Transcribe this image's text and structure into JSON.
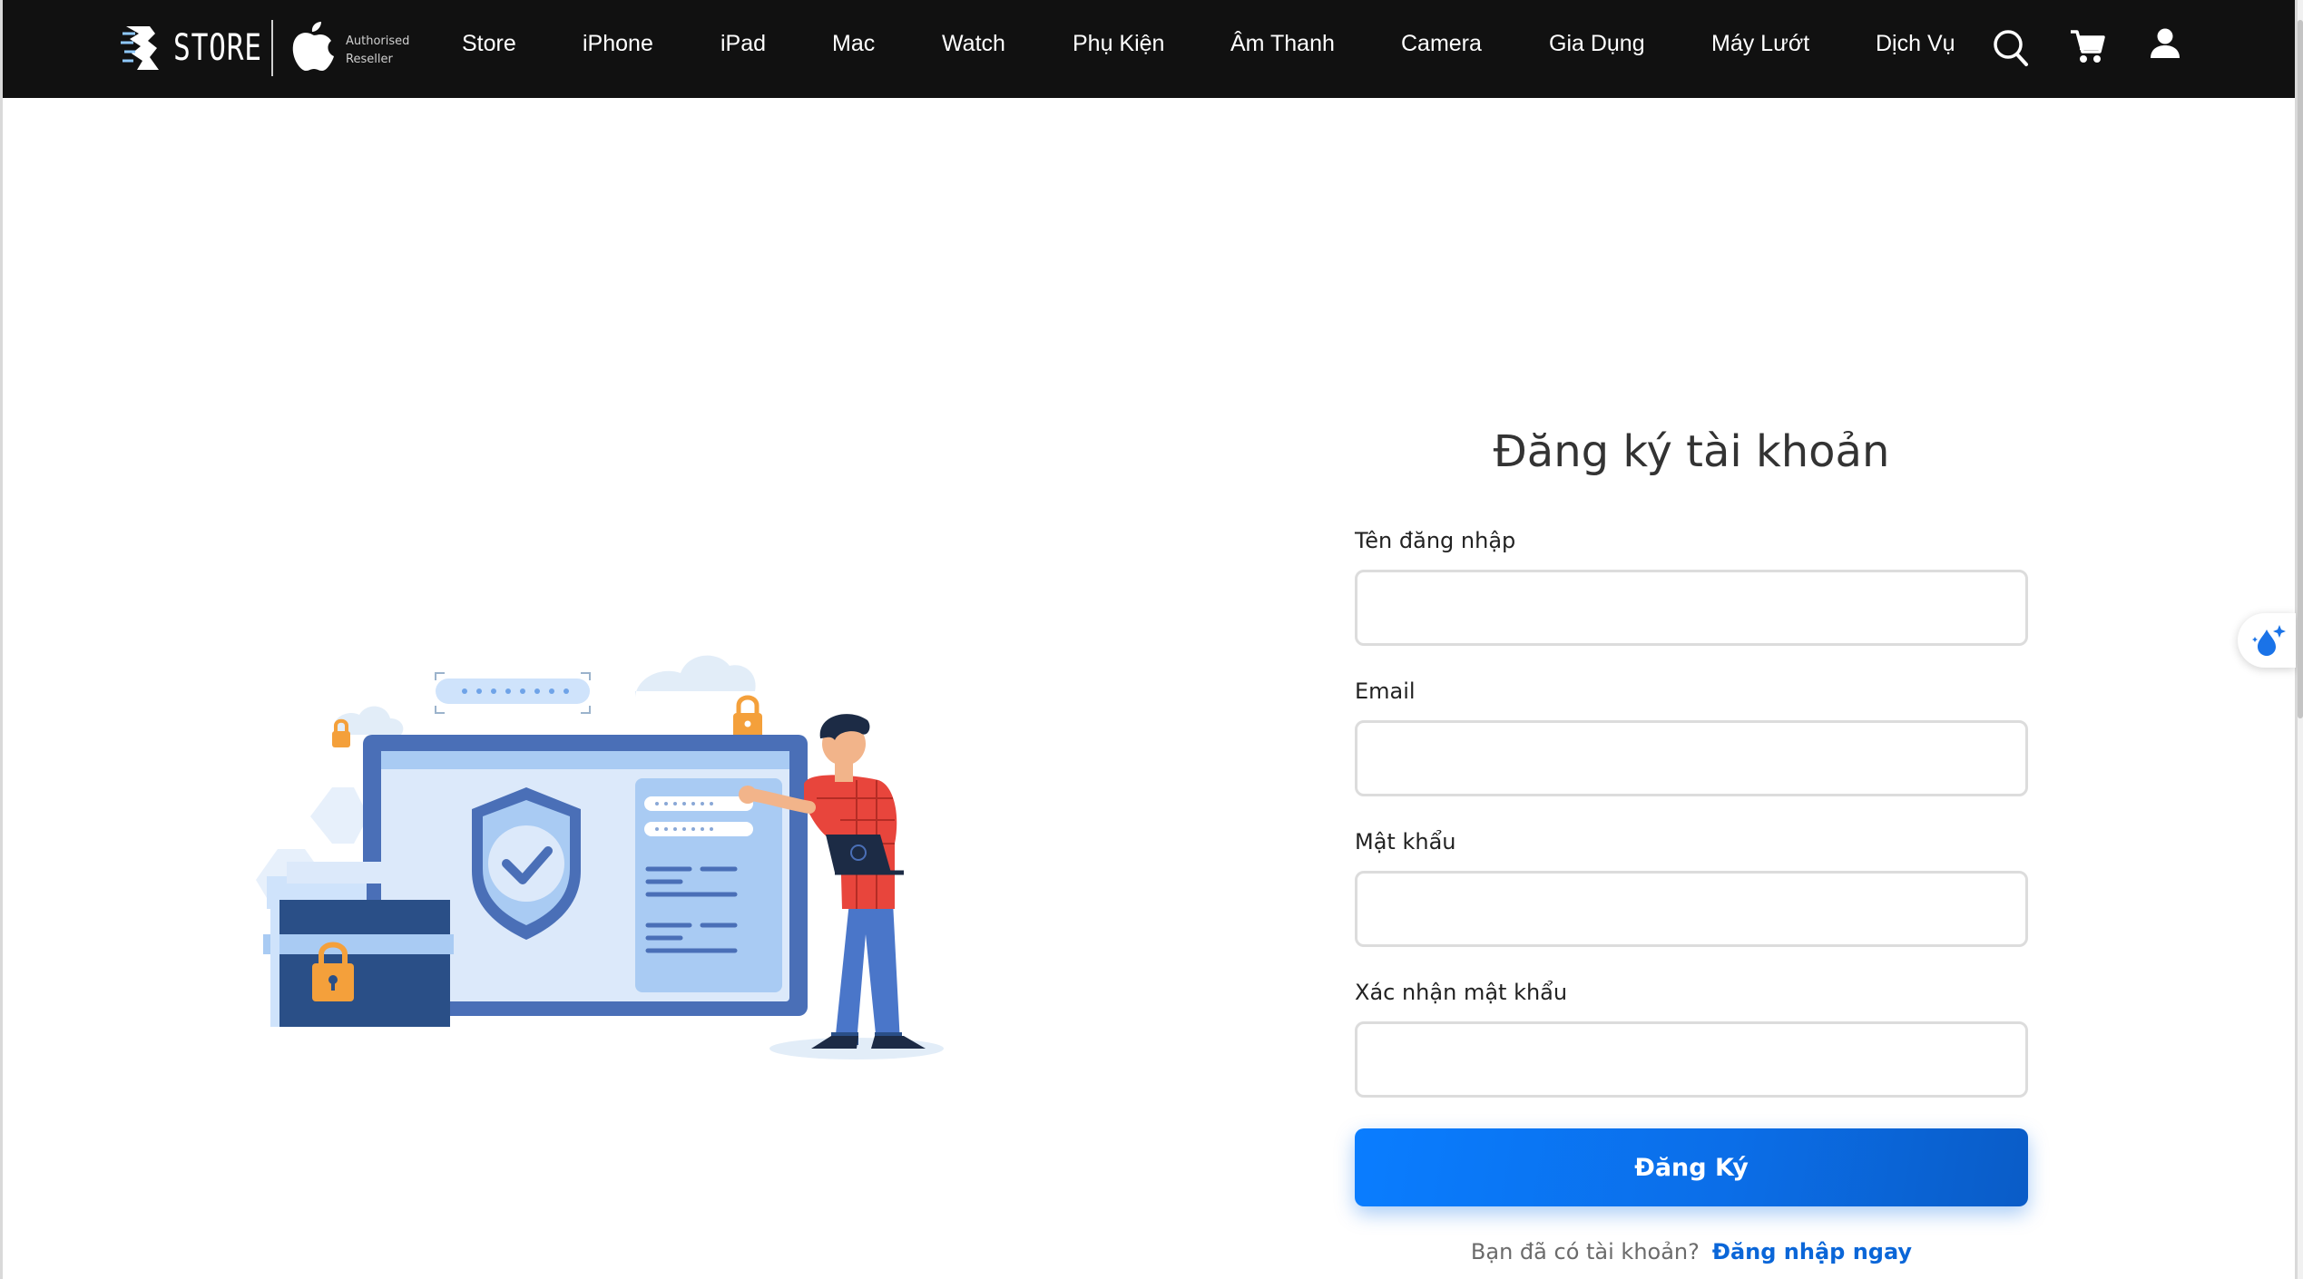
{
  "header": {
    "brand_text": "STORE",
    "reseller_line1": "Authorised",
    "reseller_line2": "Reseller",
    "nav": [
      {
        "label": "Store"
      },
      {
        "label": "iPhone"
      },
      {
        "label": "iPad"
      },
      {
        "label": "Mac"
      },
      {
        "label": "Watch"
      },
      {
        "label": "Phụ Kiện"
      },
      {
        "label": "Âm Thanh"
      },
      {
        "label": "Camera"
      },
      {
        "label": "Gia Dụng"
      },
      {
        "label": "Máy Lướt"
      },
      {
        "label": "Dịch Vụ"
      }
    ],
    "icons": [
      "search-icon",
      "cart-icon",
      "user-icon"
    ]
  },
  "form": {
    "title": "Đăng ký tài khoản",
    "username_label": "Tên đăng nhập",
    "username_value": "",
    "email_label": "Email",
    "email_value": "",
    "password_label": "Mật khẩu",
    "password_value": "",
    "confirm_label": "Xác nhận mật khẩu",
    "confirm_value": "",
    "submit_label": "Đăng Ký",
    "login_prompt": "Bạn đã có tài khoản?",
    "login_link": "Đăng nhập ngay"
  },
  "colors": {
    "nav_bg": "#111111",
    "accent": "#0a6ee8",
    "link": "#0a66d8"
  }
}
